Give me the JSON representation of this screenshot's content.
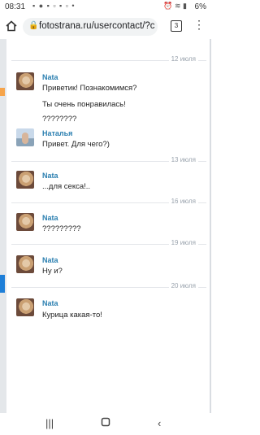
{
  "status_bar": {
    "time": "08:31",
    "battery": "6%"
  },
  "browser": {
    "url": "fotostrana.ru/usercontact/?c",
    "tab_count": "3"
  },
  "chat": {
    "dates": [
      "12 июля",
      "13 июля",
      "16 июля",
      "19 июля",
      "20 июля"
    ],
    "messages": [
      {
        "sender": "Nata",
        "lines": [
          "Приветик! Познакомимся?",
          "Ты очень понравилась!",
          "????????"
        ]
      },
      {
        "sender": "Наталья",
        "lines": [
          "Привет. Для чего?)"
        ]
      },
      {
        "sender": "Nata",
        "lines": [
          "...для секса!.."
        ]
      },
      {
        "sender": "Nata",
        "lines": [
          "?????????"
        ]
      },
      {
        "sender": "Nata",
        "lines": [
          "Ну и?"
        ]
      },
      {
        "sender": "Nata",
        "lines": [
          "Курица какая-то!"
        ]
      }
    ]
  },
  "colors": {
    "sender_name": "#2b7fb0",
    "date_label": "#9aa3ad"
  }
}
